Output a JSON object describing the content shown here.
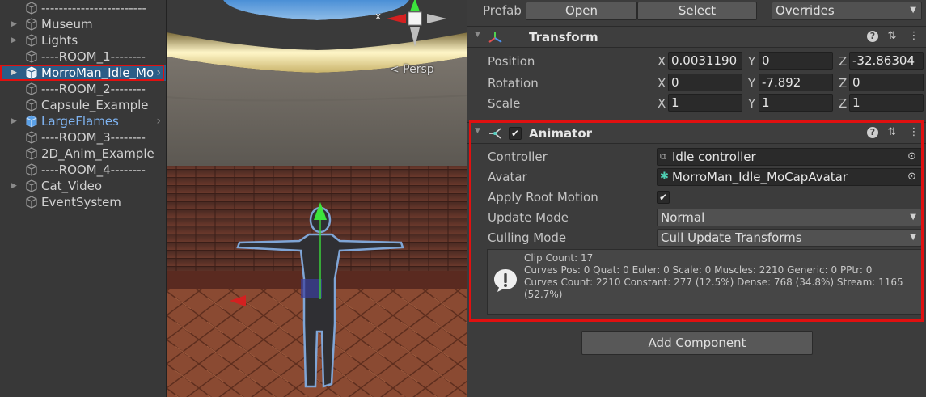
{
  "hierarchy": {
    "items": [
      {
        "label": "------------------------"
      },
      {
        "label": "Museum"
      },
      {
        "label": "Lights"
      },
      {
        "label": "----ROOM_1--------"
      },
      {
        "label": "MorroMan_Idle_Mo"
      },
      {
        "label": "----ROOM_2--------"
      },
      {
        "label": "Capsule_Example"
      },
      {
        "label": "LargeFlames"
      },
      {
        "label": "----ROOM_3--------"
      },
      {
        "label": "2D_Anim_Example"
      },
      {
        "label": "----ROOM_4--------"
      },
      {
        "label": "Cat_Video"
      },
      {
        "label": "EventSystem"
      }
    ]
  },
  "scene": {
    "persp_label": "< Persp",
    "gizmo_x_label": "x"
  },
  "inspector": {
    "prefab": {
      "label": "Prefab",
      "open": "Open",
      "select": "Select",
      "overrides": "Overrides"
    },
    "transform": {
      "title": "Transform",
      "position": {
        "label": "Position",
        "x": "0.0031190",
        "y": "0",
        "z": "-32.86304"
      },
      "rotation": {
        "label": "Rotation",
        "x": "0",
        "y": "-7.892",
        "z": "0"
      },
      "scale": {
        "label": "Scale",
        "x": "1",
        "y": "1",
        "z": "1"
      },
      "axis": {
        "x": "X",
        "y": "Y",
        "z": "Z"
      }
    },
    "animator": {
      "title": "Animator",
      "enabled": true,
      "controller": {
        "label": "Controller",
        "value": "Idle controller"
      },
      "avatar": {
        "label": "Avatar",
        "value": "MorroMan_Idle_MoCapAvatar"
      },
      "apply_root_motion": {
        "label": "Apply Root Motion",
        "checked": true
      },
      "update_mode": {
        "label": "Update Mode",
        "value": "Normal"
      },
      "culling_mode": {
        "label": "Culling Mode",
        "value": "Cull Update Transforms"
      },
      "info": {
        "line1": "Clip Count: 17",
        "line2": "Curves Pos: 0 Quat: 0 Euler: 0 Scale: 0 Muscles: 2210 Generic: 0 PPtr: 0",
        "line3": "Curves Count: 2210 Constant: 277 (12.5%) Dense: 768 (34.8%) Stream: 1165 (52.7%)"
      }
    },
    "add_component": "Add Component"
  },
  "colors": {
    "selection": "#2c5d87",
    "highlight_outline": "#e01010",
    "prefab_text": "#7fb4f2",
    "inspector_bg": "#3c3c3c"
  }
}
